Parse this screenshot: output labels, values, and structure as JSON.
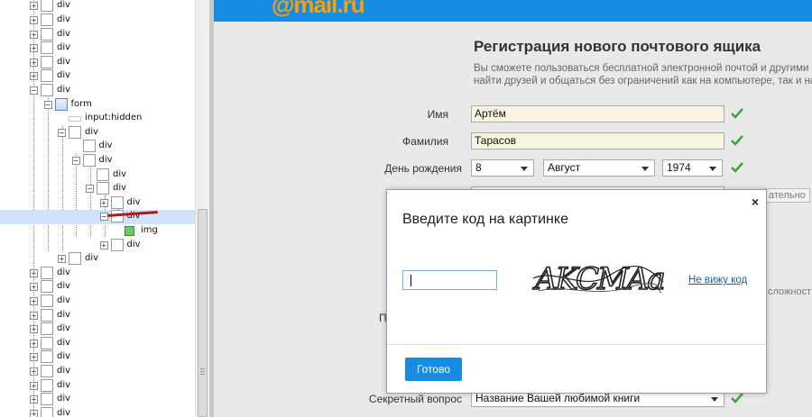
{
  "tree": {
    "rows": [
      {
        "label": "div",
        "expander": "+"
      },
      {
        "label": "div",
        "expander": "+"
      },
      {
        "label": "div",
        "expander": "+"
      },
      {
        "label": "div",
        "expander": "+"
      },
      {
        "label": "div",
        "expander": "+"
      },
      {
        "label": "div",
        "expander": "+"
      },
      {
        "label": "div",
        "expander": "−"
      },
      {
        "label": "form",
        "expander": "−"
      },
      {
        "label": "input:hidden",
        "expander": ""
      },
      {
        "label": "div",
        "expander": "−"
      },
      {
        "label": "div",
        "expander": ""
      },
      {
        "label": "div",
        "expander": "−"
      },
      {
        "label": "div",
        "expander": ""
      },
      {
        "label": "div",
        "expander": "−"
      },
      {
        "label": "div",
        "expander": "+"
      },
      {
        "label": "div",
        "expander": "−"
      },
      {
        "label": "img",
        "expander": ""
      },
      {
        "label": "div",
        "expander": "+"
      },
      {
        "label": "div",
        "expander": "+"
      },
      {
        "label": "div",
        "expander": "+"
      },
      {
        "label": "div",
        "expander": "+"
      },
      {
        "label": "div",
        "expander": "+"
      },
      {
        "label": "div",
        "expander": "+"
      },
      {
        "label": "div",
        "expander": "+"
      },
      {
        "label": "div",
        "expander": "+"
      },
      {
        "label": "div",
        "expander": "+"
      },
      {
        "label": "div",
        "expander": "+"
      },
      {
        "label": "div",
        "expander": "+"
      },
      {
        "label": "div",
        "expander": "+"
      },
      {
        "label": "div",
        "expander": "+"
      }
    ]
  },
  "page": {
    "logo": "@mail.ru",
    "title": "Регистрация нового почтового ящика",
    "description_line1": "Вы сможете пользоваться бесплатной электронной почтой и другими прод",
    "description_line2": "найти друзей и общаться без ограничений как на компьютере, так и на моб",
    "first_name_label": "Имя",
    "first_name_value": "Артём",
    "last_name_label": "Фамилия",
    "last_name_value": "Тарасов",
    "birthday_label": "День рождения",
    "birth_day": "8",
    "birth_month": "Август",
    "birth_year": "1974",
    "hidden_right_text": "ательно",
    "hidden_right_text2": "сложност",
    "hidden_label_fragment": "П",
    "secret_question_label": "Секретный вопрос",
    "secret_question_value": "Название Вашей любимой книги",
    "colors": {
      "brand_blue": "#168de2",
      "logo_orange": "#ff9e00",
      "check_green": "#3aa63a"
    }
  },
  "modal": {
    "close": "×",
    "title": "Введите код на картинке",
    "captcha_text": "AKCMAa",
    "no_see_link": "Не вижу код",
    "ok_button": "Готово"
  }
}
